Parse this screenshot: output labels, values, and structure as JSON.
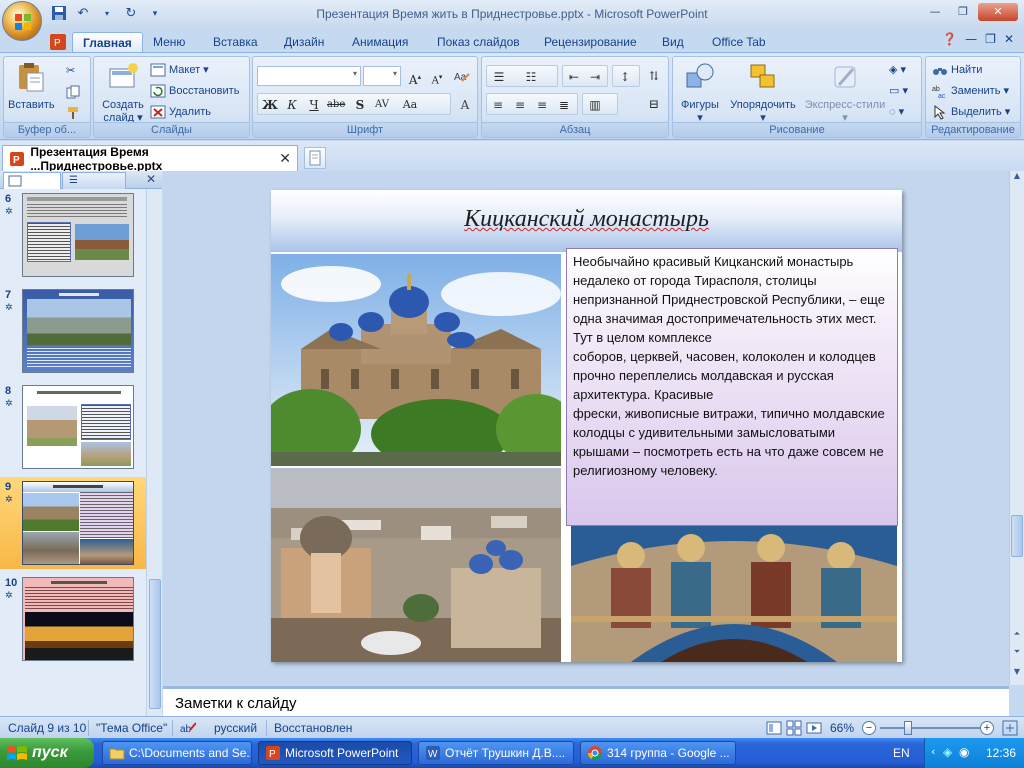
{
  "window": {
    "title": "Презентация  Время жить в Приднестровье.pptx - Microsoft PowerPoint"
  },
  "ribbon": {
    "tabs": [
      "Главная",
      "Меню",
      "Вставка",
      "Дизайн",
      "Анимация",
      "Показ слайдов",
      "Рецензирование",
      "Вид",
      "Office Tab"
    ],
    "active_tab": "Главная",
    "clipboard": {
      "paste": "Вставить",
      "label": "Буфер об..."
    },
    "slides": {
      "new_slide": "Создать слайд",
      "layout": "Макет",
      "reset": "Восстановить",
      "delete": "Удалить",
      "label": "Слайды"
    },
    "font": {
      "label": "Шрифт"
    },
    "paragraph": {
      "label": "Абзац"
    },
    "drawing": {
      "shapes": "Фигуры",
      "arrange": "Упорядочить",
      "express_styles": "Экспресс-стили",
      "label": "Рисование"
    },
    "editing": {
      "find": "Найти",
      "replace": "Заменить",
      "select": "Выделить",
      "label": "Редактирование"
    }
  },
  "doc_tab": {
    "label": "Презентация  Время ...Приднестровье.pptx"
  },
  "slide_panel": {
    "thumbnails": [
      {
        "number": "6",
        "selected": false
      },
      {
        "number": "7",
        "selected": false
      },
      {
        "number": "8",
        "selected": false
      },
      {
        "number": "9",
        "selected": true
      },
      {
        "number": "10",
        "selected": false
      }
    ]
  },
  "slide": {
    "title": "Кицканский монастырь",
    "body_p1": "Необычайно красивый Кицканский монастырь недалеко от города Тирасполя, столицы непризнанной Приднестровской Республики, – еще одна значимая достопримечательность этих мест. Тут в целом комплексе",
    "body_p2": "соборов, церквей, часовен, колоколен и колодцев прочно переплелись молдавская и русская архитектура. Красивые",
    "body_p3": "фрески, живописные витражи, типично молдавские колодцы с удивительными замысловатыми крышами – посмотреть есть на что даже совсем не религиозному человеку."
  },
  "notes": {
    "placeholder": "Заметки к слайду"
  },
  "status": {
    "slide_pos": "Слайд 9 из 10",
    "theme": "\"Тема Office\"",
    "language": "русский",
    "state": "Восстановлен",
    "zoom": "66%"
  },
  "taskbar": {
    "start": "пуск",
    "tasks": [
      {
        "label": "C:\\Documents and Se...",
        "active": false
      },
      {
        "label": "Microsoft PowerPoint",
        "active": true
      },
      {
        "label": "Отчёт Трушкин Д.В....",
        "active": false
      },
      {
        "label": "314 группа - Google ...",
        "active": false
      }
    ],
    "lang": "EN",
    "clock": "12:36"
  },
  "colors": {
    "ribbon_bg": "#c9dcf2",
    "accent": "#15428b",
    "selected_thumb": "#f8b748",
    "textbox_bg": "#d9c6ec",
    "taskbar": "#245dd4"
  }
}
